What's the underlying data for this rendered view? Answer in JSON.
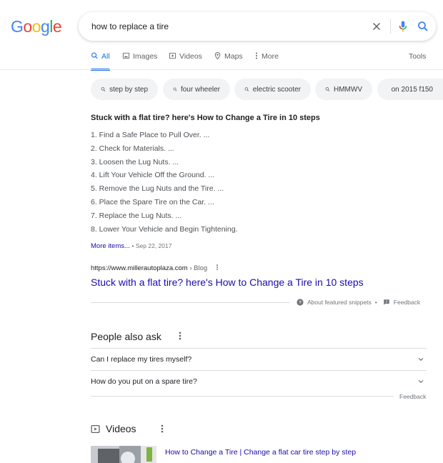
{
  "logo": {
    "letters": [
      "G",
      "o",
      "o",
      "g",
      "l",
      "e"
    ],
    "colors": [
      "#4285f4",
      "#ea4335",
      "#fbbc05",
      "#4285f4",
      "#34a853",
      "#ea4335"
    ]
  },
  "search": {
    "query": "how to replace a tire"
  },
  "tabs": [
    {
      "label": "All",
      "icon": "search-icon",
      "active": true
    },
    {
      "label": "Images",
      "icon": "image-icon"
    },
    {
      "label": "Videos",
      "icon": "video-icon"
    },
    {
      "label": "Maps",
      "icon": "map-pin-icon"
    },
    {
      "label": "More",
      "icon": "more-vert-icon"
    }
  ],
  "tools_label": "Tools",
  "chips": [
    "step by step",
    "four wheeler",
    "electric scooter",
    "HMMWV",
    "on 2015 f150"
  ],
  "featured_snippet": {
    "title": "Stuck with a flat tire? here's How to Change a Tire in 10 steps",
    "steps": [
      "1. Find a Safe Place to Pull Over. ...",
      "2. Check for Materials. ...",
      "3. Loosen the Lug Nuts. ...",
      "4. Lift Your Vehicle Off the Ground. ...",
      "5. Remove the Lug Nuts and the Tire. ...",
      "6. Place the Spare Tire on the Car. ...",
      "7. Replace the Lug Nuts. ...",
      "8. Lower Your Vehicle and Begin Tightening."
    ],
    "more_items": "More items...",
    "date": "• Sep 22, 2017",
    "url": "https://www.millerautoplaza.com",
    "breadcrumb": "› Blog",
    "result_title": "Stuck with a flat tire? here's How to Change a Tire in 10 steps",
    "about_label": "About featured snippets",
    "bullet": "•",
    "feedback_label": "Feedback"
  },
  "people_also_ask": {
    "title": "People also ask",
    "questions": [
      "Can I replace my tires myself?",
      "How do you put on a spare tire?"
    ],
    "feedback_label": "Feedback"
  },
  "videos": {
    "title": "Videos",
    "first_title": "How to Change a Tire | Change a flat car tire step by step"
  }
}
